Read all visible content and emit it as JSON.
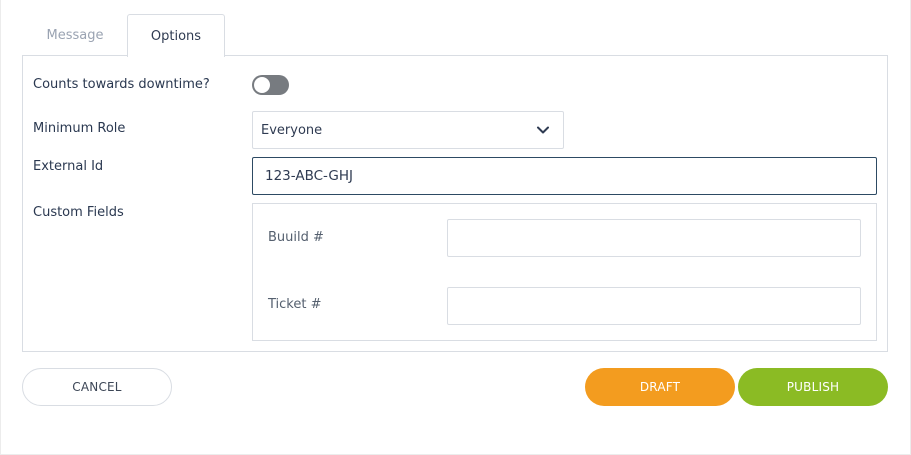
{
  "tabs": {
    "message": "Message",
    "options": "Options"
  },
  "form": {
    "downtime_label": "Counts towards downtime?",
    "downtime_enabled": false,
    "min_role_label": "Minimum Role",
    "min_role_value": "Everyone",
    "external_id_label": "External Id",
    "external_id_value": "123-ABC-GHJ",
    "custom_fields_label": "Custom Fields",
    "custom_fields": [
      {
        "label": "Buuild #",
        "value": ""
      },
      {
        "label": "Ticket #",
        "value": ""
      }
    ]
  },
  "buttons": {
    "cancel": "CANCEL",
    "draft": "DRAFT",
    "publish": "PUBLISH"
  },
  "colors": {
    "draft": "#f39c1f",
    "publish": "#8bbb24",
    "toggle_off": "#777b80",
    "input_focus_border": "#2d4a63"
  }
}
